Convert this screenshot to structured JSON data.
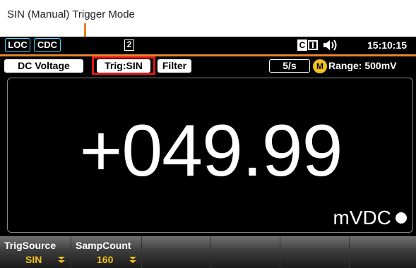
{
  "annotation": {
    "text": "SIN (Manual) Trigger Mode"
  },
  "status_bar": {
    "loc_label": "LOC",
    "cdc_label": "CDC",
    "slot_number": "2",
    "c_icon_label": "C",
    "time": "15:10:15"
  },
  "function_bar": {
    "function_label": "DC Voltage",
    "trigger_label": "Trig:SIN",
    "filter_label": "Filter",
    "rate_label": "5/s",
    "m_icon_label": "M",
    "range_label": "Range: 500mV"
  },
  "display": {
    "reading": "+049.99",
    "unit": "mVDC"
  },
  "softkeys": [
    {
      "label": "TrigSource",
      "value": "SIN"
    },
    {
      "label": "SampCount",
      "value": "160"
    },
    {
      "label": "",
      "value": ""
    },
    {
      "label": "",
      "value": ""
    },
    {
      "label": "",
      "value": ""
    },
    {
      "label": "",
      "value": ""
    }
  ],
  "colors": {
    "accent_orange": "#e8832a",
    "highlight_red": "#e01919",
    "value_yellow": "#f2c21b",
    "status_cyan": "#3fd6ff"
  }
}
